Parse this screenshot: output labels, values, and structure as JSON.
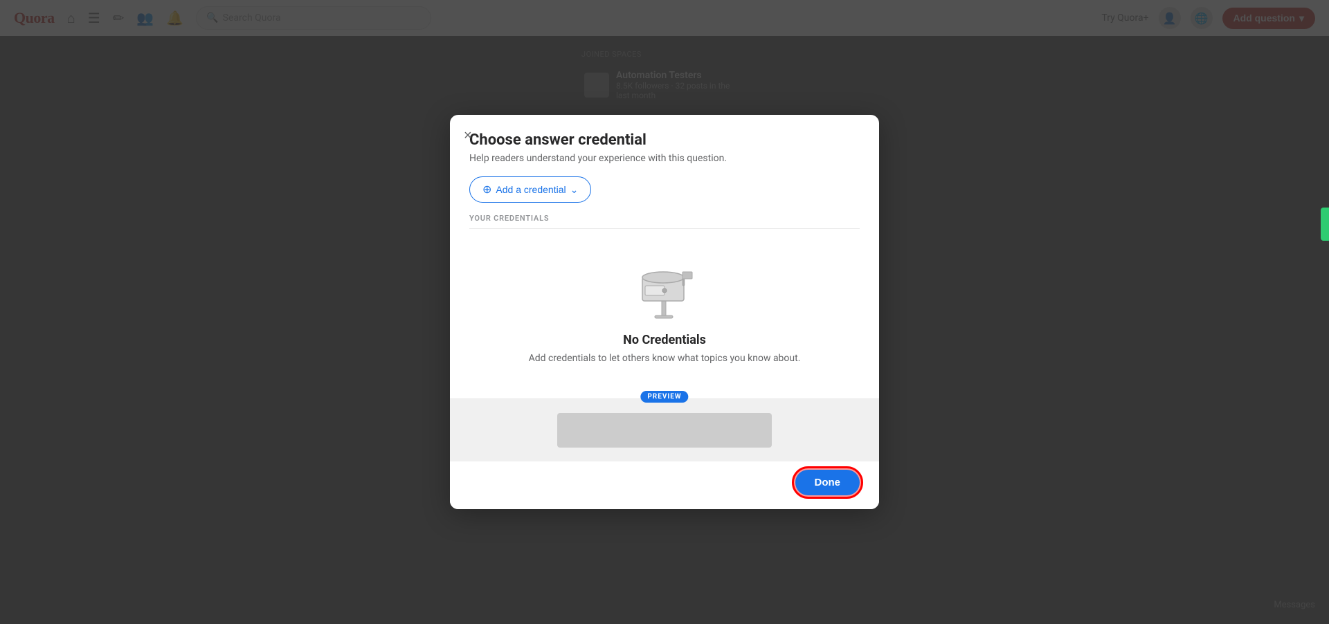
{
  "navbar": {
    "logo": "Quora",
    "search_placeholder": "Search Quora",
    "try_quora_label": "Try Quora+",
    "add_question_label": "Add question"
  },
  "modal": {
    "title": "Choose answer credential",
    "subtitle": "Help readers understand your experience with this question.",
    "close_label": "×",
    "add_credential_label": "Add a credential",
    "credentials_section_label": "YOUR CREDENTIALS",
    "no_credentials_title": "No Credentials",
    "no_credentials_desc": "Add credentials to let others know what topics you know about.",
    "preview_badge": "PREVIEW",
    "done_button_label": "Done"
  },
  "sidebar": {
    "spaces_label": "Joined Spaces",
    "spaces": [
      {
        "name": "Automation Testers",
        "meta": "8.5K followers · 32 posts in the last month"
      }
    ]
  },
  "icons": {
    "close": "×",
    "plus_circle": "⊕",
    "chevron_down": "⌄",
    "home": "⌂",
    "feed": "☰",
    "edit": "✏",
    "people": "👥",
    "bell": "🔔",
    "globe": "🌐",
    "messages": "Messages"
  }
}
